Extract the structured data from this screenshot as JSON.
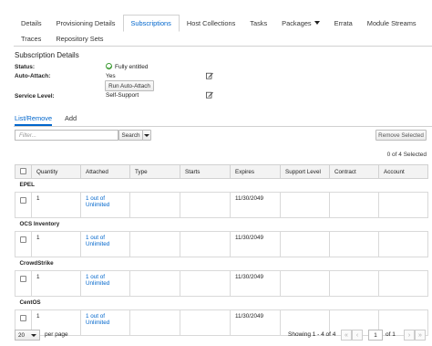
{
  "tabs_row1": [
    "Details",
    "Provisioning Details",
    "Subscriptions",
    "Host Collections",
    "Tasks",
    "Packages",
    "Errata",
    "Module Streams"
  ],
  "tabs_row2": [
    "Traces",
    "Repository Sets"
  ],
  "details": {
    "title": "Subscription Details",
    "status_label": "Status:",
    "status_value": "Fully entitled",
    "auto_attach_label": "Auto-Attach:",
    "auto_attach_value": "Yes",
    "run_auto_attach": "Run Auto-Attach",
    "service_level_label": "Service Level:",
    "service_level_value": "Self-Support"
  },
  "subtabs": {
    "list_remove": "List/Remove",
    "add": "Add"
  },
  "filter": {
    "placeholder": "Filter...",
    "search": "Search"
  },
  "remove_selected": "Remove Selected",
  "selected_count": "0 of 4 Selected",
  "columns": [
    "Quantity",
    "Attached",
    "Type",
    "Starts",
    "Expires",
    "Support Level",
    "Contract",
    "Account"
  ],
  "groups": [
    {
      "name": "EPEL",
      "quantity": "1",
      "attached_1": "1 out of",
      "attached_2": "Unlimited",
      "expires": "11/30/2049"
    },
    {
      "name": "OCS Inventory",
      "quantity": "1",
      "attached_1": "1 out of",
      "attached_2": "Unlimited",
      "expires": "11/30/2049"
    },
    {
      "name": "CrowdStrike",
      "quantity": "1",
      "attached_1": "1 out of",
      "attached_2": "Unlimited",
      "expires": "11/30/2049"
    },
    {
      "name": "CentOS",
      "quantity": "1",
      "attached_1": "1 out of",
      "attached_2": "Unlimited",
      "expires": "11/30/2049"
    }
  ],
  "pagination": {
    "per_page_value": "20",
    "per_page_label": "per page",
    "showing": "Showing 1 - 4 of 4",
    "page": "1",
    "of_pages": "of 1"
  },
  "colors": {
    "link": "#0066cc",
    "ok": "#3f9c35"
  }
}
